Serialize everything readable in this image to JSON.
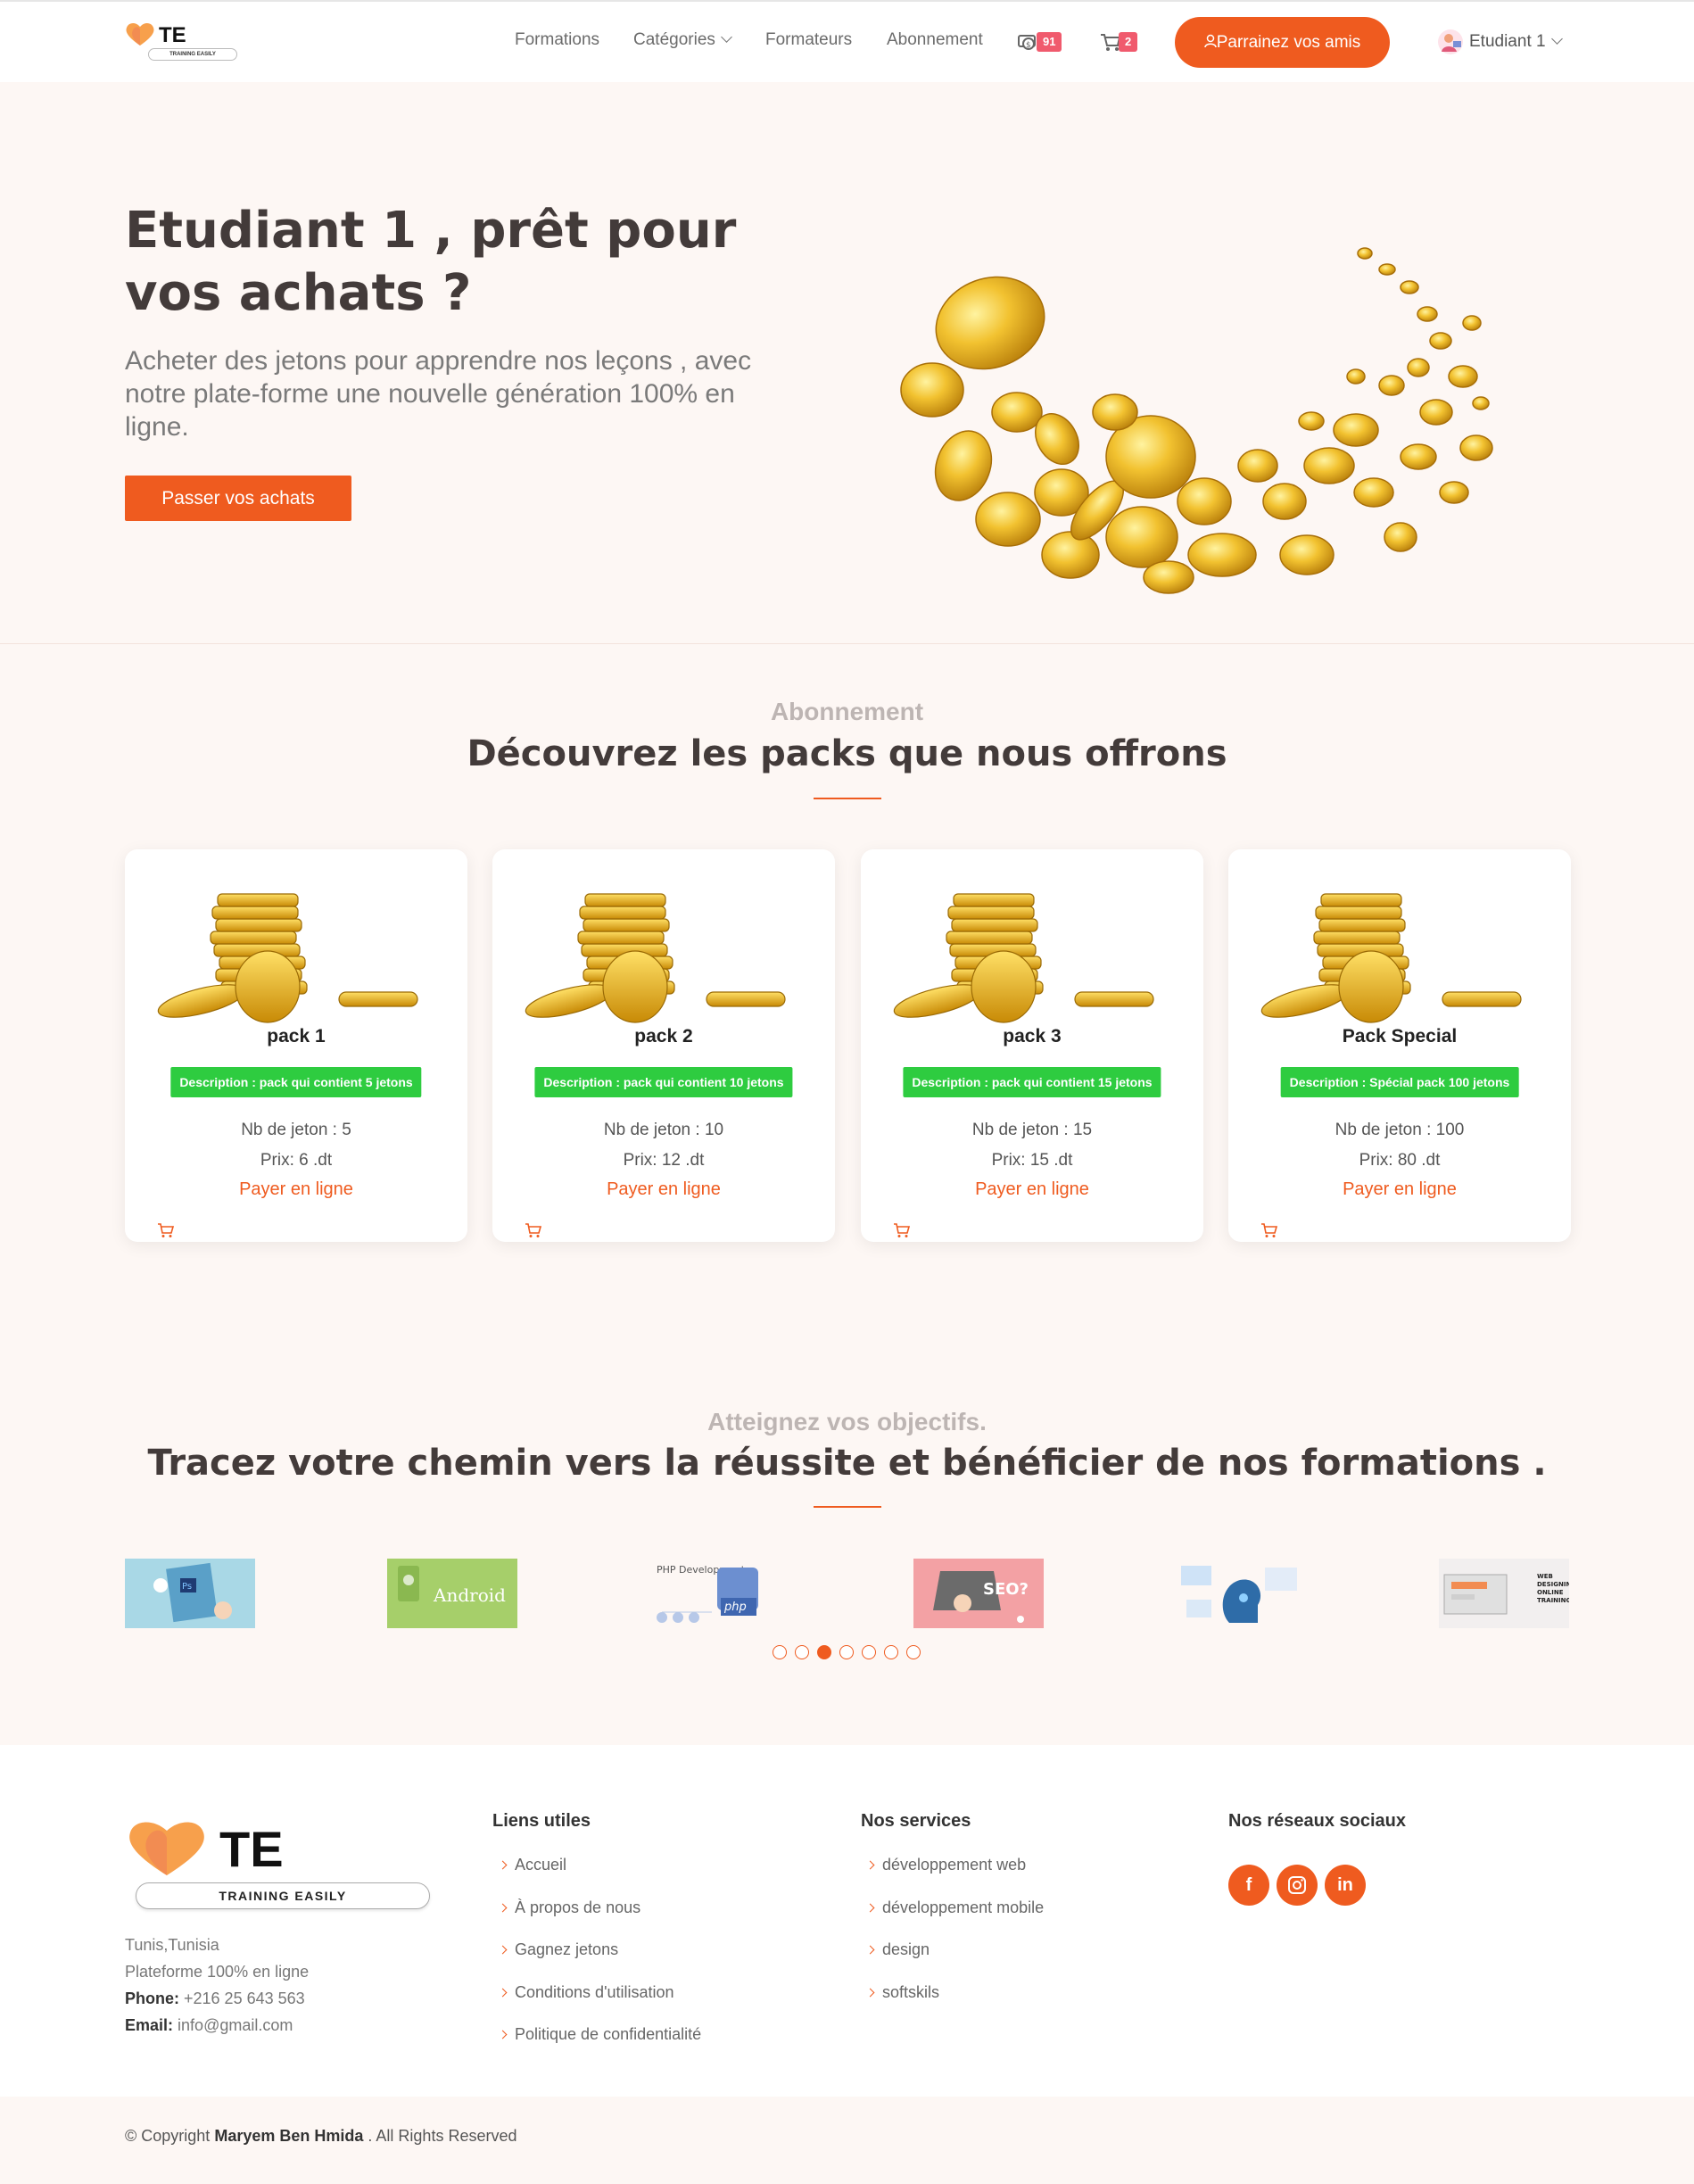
{
  "header": {
    "logo_text": "TE",
    "logo_tagline": "TRAINING EASILY",
    "nav": {
      "formations": "Formations",
      "categories": "Catégories",
      "formateurs": "Formateurs",
      "abonnement": "Abonnement"
    },
    "tokens_count": "91",
    "cart_count": "2",
    "parrain_label": "Parrainez vos amis",
    "user_name": "Etudiant 1"
  },
  "hero": {
    "title": "Etudiant 1 , prêt pour vos achats ?",
    "subtitle": "Acheter des jetons pour apprendre nos leçons , avec notre plate-forme une nouvelle génération 100% en ligne.",
    "button": "Passer vos achats"
  },
  "packs_section": {
    "small": "Abonnement",
    "title": "Découvrez les packs que nous offrons",
    "packs": [
      {
        "name": "pack 1",
        "desc": "Description : pack qui contient 5 jetons",
        "nb": "Nb de jeton : 5",
        "prix": "Prix: 6 .dt",
        "pay": "Payer en ligne"
      },
      {
        "name": "pack 2",
        "desc": "Description : pack qui contient 10 jetons",
        "nb": "Nb de jeton : 10",
        "prix": "Prix: 12 .dt",
        "pay": "Payer en ligne"
      },
      {
        "name": "pack 3",
        "desc": "Description : pack qui contient 15 jetons",
        "nb": "Nb de jeton : 15",
        "prix": "Prix: 15 .dt",
        "pay": "Payer en ligne"
      },
      {
        "name": "Pack Special",
        "desc": "Description : Spécial pack 100 jetons",
        "nb": "Nb de jeton : 100",
        "prix": "Prix: 80 .dt",
        "pay": "Payer en ligne"
      }
    ]
  },
  "goals_section": {
    "small": "Atteignez vos objectifs.",
    "title": "Tracez votre chemin vers la réussite et bénéficier de nos formations .",
    "thumbs": {
      "android": "Android",
      "php_label": "PHP Development",
      "php": "php",
      "seo": "SEO?",
      "web": "WEB DESIGNING ONLINE TRAINING"
    },
    "active_dot": 3
  },
  "footer": {
    "logo_text": "TE",
    "logo_tagline": "TRAINING EASILY",
    "address": "Tunis,Tunisia",
    "platform": "Plateforme 100% en ligne",
    "phone_label": "Phone:",
    "phone": "+216 25 643 563",
    "email_label": "Email:",
    "email": "info@gmail.com",
    "useful_links_title": "Liens utiles",
    "useful_links": [
      "Accueil",
      "À propos de nous",
      "Gagnez jetons",
      "Conditions d'utilisation",
      "Politique de confidentialité"
    ],
    "services_title": "Nos services",
    "services": [
      "développement web",
      "développement mobile",
      "design",
      "softskils"
    ],
    "social_title": "Nos réseaux sociaux",
    "social": {
      "facebook": "f",
      "linkedin": "in"
    },
    "copyright_prefix": "© Copyright",
    "copyright_name": "Maryem Ben Hmida",
    "copyright_suffix": ". All Rights Reserved"
  },
  "colors": {
    "accent": "#ef5b1f",
    "badge": "#f05a6d",
    "desc_green": "#2ecc40",
    "title_dark": "#433b3a",
    "bg": "#fdf7f4"
  }
}
